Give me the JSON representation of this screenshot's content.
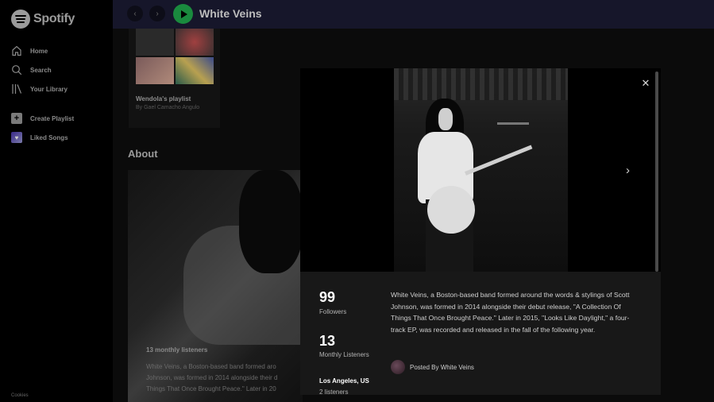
{
  "sidebar": {
    "logo_text": "Spotify",
    "items": [
      {
        "label": "Home",
        "icon": "home-icon"
      },
      {
        "label": "Search",
        "icon": "search-icon"
      },
      {
        "label": "Your Library",
        "icon": "library-icon"
      },
      {
        "label": "Create Playlist",
        "icon": "plus-icon"
      },
      {
        "label": "Liked Songs",
        "icon": "heart-icon"
      }
    ],
    "cookies": "Cookies"
  },
  "topbar": {
    "title": "White Veins",
    "back_icon": "chevron-left-icon",
    "forward_icon": "chevron-right-icon",
    "play_icon": "play-icon",
    "bg_color": "#16162a",
    "play_color": "#1a8a3e"
  },
  "main": {
    "playlist": {
      "title": "Wendola's playlist",
      "subtitle": "By Gael Camacho Angulo"
    },
    "about_heading": "About",
    "about_listeners": "13 monthly listeners",
    "about_bio": "White Veins, a Boston-based band formed aro\nJohnson, was formed in 2014 alongside their d\nThings That Once Brought Peace.\" Later in 20"
  },
  "modal": {
    "followers_value": "99",
    "followers_label": "Followers",
    "monthly_value": "13",
    "monthly_label": "Monthly Listeners",
    "location": "Los Angeles, US",
    "location_listeners": "2 listeners",
    "bio": "White Veins, a Boston-based band formed around the words & stylings of Scott Johnson, was formed in 2014 alongside their debut release, \"A Collection Of Things That Once Brought Peace.\" Later in 2015, \"Looks Like Daylight,\" a four-track EP, was recorded and released in the fall of the following year.",
    "posted_by": "Posted By White Veins",
    "close_icon": "close-icon",
    "next_icon": "chevron-right-icon"
  }
}
